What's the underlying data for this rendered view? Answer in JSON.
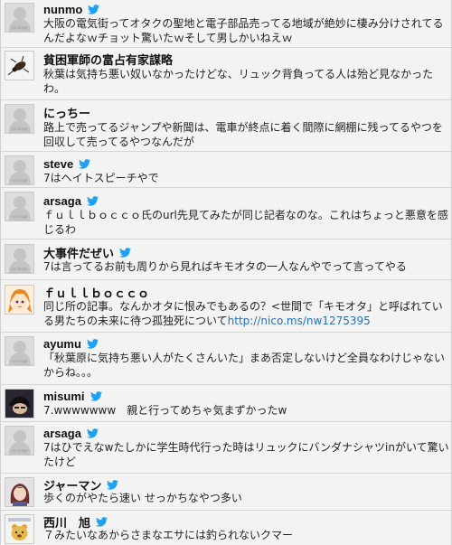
{
  "placeholder_label": "no image",
  "tweets": [
    {
      "name": "nunmo",
      "text": "大阪の電気街ってオタクの聖地と電子部品売ってる地域が絶妙に棲み分けされてるんだよなｗチョット驚いたｗそして男しかいねえｗ",
      "link": "",
      "avatar": "noimage"
    },
    {
      "name": "貧困軍師の富占有家謀略",
      "text": "秋葉は気持ち悪い奴いなかったけどな、リュック背負ってる人は殆ど見なかったわ。",
      "link": "",
      "avatar": "insect"
    },
    {
      "name": "にっちー",
      "text": "路上で売ってるジャンプや新聞は、電車が終点に着く間際に網棚に残ってるやつを回収して売ってるやつなんだが",
      "link": "",
      "avatar": "noimage"
    },
    {
      "name": "steve",
      "text": "7はヘイトスピーチやで",
      "link": "",
      "avatar": "noimage"
    },
    {
      "name": "arsaga",
      "text": "ｆｕｌｌｂｏｃｃｏ氏のurl先見てみたが同じ記者なのな。これはちょっと悪意を感じるわ",
      "link": "",
      "avatar": "noimage"
    },
    {
      "name": "大事件だぜい",
      "text": "7は言ってるお前も周りから見ればキモオタの一人なんやでって言ってやる",
      "link": "",
      "avatar": "noimage"
    },
    {
      "name": "ｆｕｌｌｂｏｃｃｏ",
      "text": "同じ所の記事。なんかオタに恨みでもあるの？<世間で「キモオタ」と呼ばれている男たちの未来に待つ孤独死について",
      "link": "http://nico.ms/nw1275395",
      "avatar": "anime"
    },
    {
      "name": "ayumu",
      "text": "「秋葉原に気持ち悪い人がたくさんいた」まあ否定しないけど全員なわけじゃないからね。。。",
      "link": "",
      "avatar": "noimage"
    },
    {
      "name": "misumi",
      "text": "7.wwwwwww　親と行ってめちゃ気まずかったw",
      "link": "",
      "avatar": "dark"
    },
    {
      "name": "arsaga",
      "text": "7はひでえなwたしかに学生時代行った時はリュックにバンダナシャツinがいて驚いたけど",
      "link": "",
      "avatar": "noimage"
    },
    {
      "name": "ジャーマン",
      "text": "歩くのがやたら速い せっかちなやつ多い",
      "link": "",
      "avatar": "girl"
    },
    {
      "name": "西川　旭",
      "text": "７みたいなあからさまなエサには釣られないクマー",
      "link": "",
      "avatar": "bear"
    }
  ]
}
